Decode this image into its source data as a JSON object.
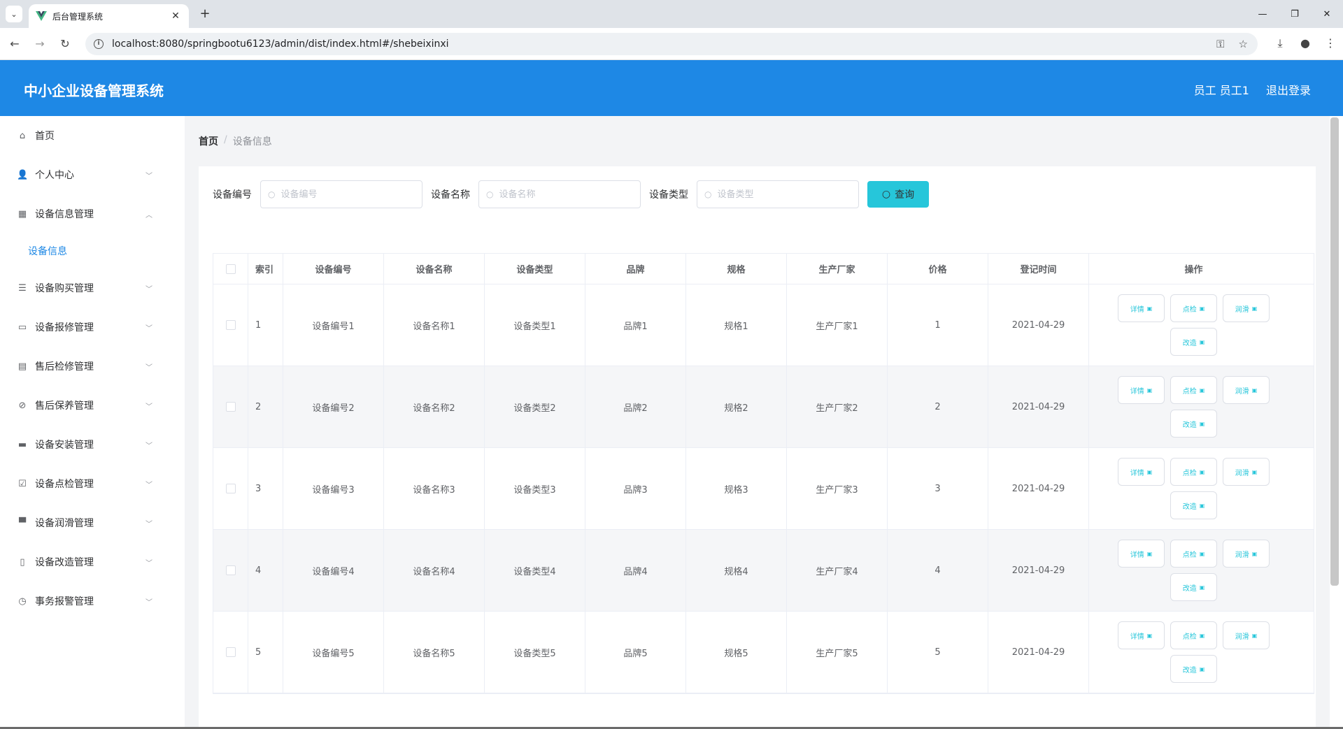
{
  "browser": {
    "tab_title": "后台管理系统",
    "url": "localhost:8080/springbootu6123/admin/dist/index.html#/shebeixinxi"
  },
  "header": {
    "title": "中小企业设备管理系统",
    "user": "员工 员工1",
    "logout": "退出登录"
  },
  "sidebar": {
    "items": [
      {
        "label": "首页",
        "icon": "home-icon"
      },
      {
        "label": "个人中心",
        "icon": "user-icon"
      },
      {
        "label": "设备信息管理",
        "icon": "grid-icon"
      },
      {
        "label": "设备信息",
        "icon": ""
      },
      {
        "label": "设备购买管理",
        "icon": "sliders-icon"
      },
      {
        "label": "设备报修管理",
        "icon": "chat-icon"
      },
      {
        "label": "售后检修管理",
        "icon": "clipboard-icon"
      },
      {
        "label": "售后保养管理",
        "icon": "no-bell-icon"
      },
      {
        "label": "设备安装管理",
        "icon": "message-icon"
      },
      {
        "label": "设备点检管理",
        "icon": "checklist-icon"
      },
      {
        "label": "设备润滑管理",
        "icon": "printer-icon"
      },
      {
        "label": "设备改造管理",
        "icon": "mic-icon"
      },
      {
        "label": "事务报警管理",
        "icon": "compass-icon"
      }
    ]
  },
  "breadcrumb": {
    "home": "首页",
    "current": "设备信息"
  },
  "search": {
    "label1": "设备编号",
    "placeholder1": "设备编号",
    "label2": "设备名称",
    "placeholder2": "设备名称",
    "label3": "设备类型",
    "placeholder3": "设备类型",
    "button": "查询"
  },
  "table": {
    "headers": [
      "索引",
      "设备编号",
      "设备名称",
      "设备类型",
      "品牌",
      "规格",
      "生产厂家",
      "价格",
      "登记时间",
      "操作"
    ],
    "actions": [
      "详情",
      "点检",
      "润滑",
      "改造"
    ],
    "rows": [
      {
        "idx": "1",
        "code": "设备编号1",
        "name": "设备名称1",
        "type": "设备类型1",
        "brand": "品牌1",
        "spec": "规格1",
        "maker": "生产厂家1",
        "price": "1",
        "date": "2021-04-29"
      },
      {
        "idx": "2",
        "code": "设备编号2",
        "name": "设备名称2",
        "type": "设备类型2",
        "brand": "品牌2",
        "spec": "规格2",
        "maker": "生产厂家2",
        "price": "2",
        "date": "2021-04-29"
      },
      {
        "idx": "3",
        "code": "设备编号3",
        "name": "设备名称3",
        "type": "设备类型3",
        "brand": "品牌3",
        "spec": "规格3",
        "maker": "生产厂家3",
        "price": "3",
        "date": "2021-04-29"
      },
      {
        "idx": "4",
        "code": "设备编号4",
        "name": "设备名称4",
        "type": "设备类型4",
        "brand": "品牌4",
        "spec": "规格4",
        "maker": "生产厂家4",
        "price": "4",
        "date": "2021-04-29"
      },
      {
        "idx": "5",
        "code": "设备编号5",
        "name": "设备名称5",
        "type": "设备类型5",
        "brand": "品牌5",
        "spec": "规格5",
        "maker": "生产厂家5",
        "price": "5",
        "date": "2021-04-29"
      }
    ]
  },
  "colors": {
    "primary": "#1e88e5",
    "accent": "#26c6da"
  }
}
